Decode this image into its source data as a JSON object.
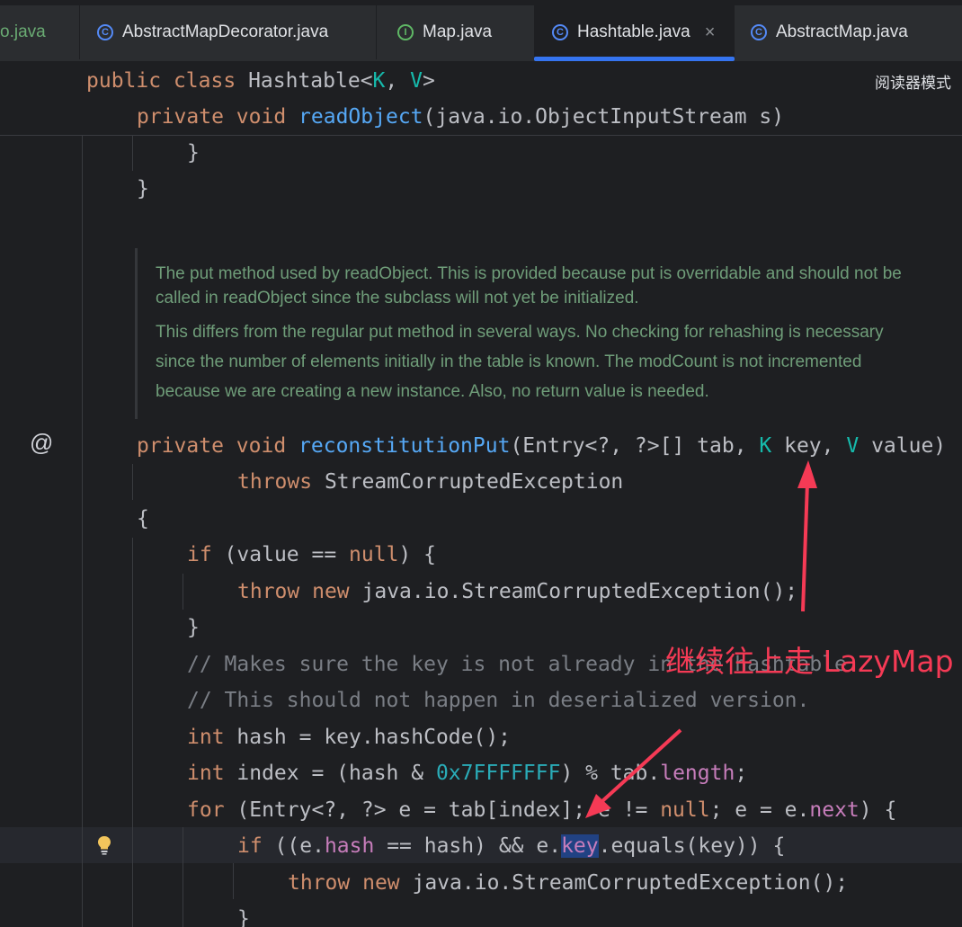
{
  "tabs": [
    {
      "label": "o.java",
      "icon": "none"
    },
    {
      "label": "AbstractMapDecorator.java",
      "icon": "class-icon"
    },
    {
      "label": "Map.java",
      "icon": "interface-icon"
    },
    {
      "label": "Hashtable.java",
      "icon": "class-icon",
      "active": true
    },
    {
      "label": "AbstractMap.java",
      "icon": "class-icon"
    }
  ],
  "tab_icon_letters": {
    "class": "C",
    "interface": "I"
  },
  "close_glyph": "×",
  "reader_mode_label": "阅读器模式",
  "sticky": {
    "line1": {
      "kw1": "public",
      "kw2": "class",
      "name": "Hashtable",
      "lt": "<",
      "k": "K",
      "comma": ", ",
      "v": "V",
      "gt": ">"
    },
    "line2": {
      "kw1": "private",
      "kw2": "void",
      "fn": "readObject",
      "rest": "(java.io.ObjectInputStream s)"
    }
  },
  "code": {
    "brace_close_inner": "}",
    "brace_close_outer": "}",
    "sig_kw1": "private",
    "sig_kw2": "void",
    "sig_fn": "reconstitutionPut",
    "sig_params_a": "(Entry<?, ?>[] tab, ",
    "sig_k": "K",
    "sig_key": " key, ",
    "sig_v": "V",
    "sig_value": " value)",
    "throws_kw": "throws",
    "throws_type": " StreamCorruptedException",
    "open_brace": "{",
    "if_kw": "if",
    "if_cond_a": " (value == ",
    "null1": "null",
    "if_cond_b": ") {",
    "throw_kw": "throw",
    "new_kw": "new",
    "throw_rest": " java.io.StreamCorruptedException();",
    "close_if": "}",
    "comment1": "// Makes sure the key is not already in the hashtable.",
    "comment2": "// This should not happen in deserialized version.",
    "int1": "int",
    "hash_decl": " hash = key.hashCode();",
    "int2": "int",
    "index_a": " index = (hash & ",
    "hex": "0x7FFFFFFF",
    "index_b": ") % tab.",
    "length": "length",
    "semi": ";",
    "for_kw": "for",
    "for_a": " (Entry<?, ?> e = tab[index]; e != ",
    "null2": "null",
    "for_b": "; e = e.",
    "next": "next",
    "for_c": ") {",
    "if2_kw": "if",
    "if2_a": " ((e.",
    "hash_fld": "hash",
    "if2_b": " == hash) && e.",
    "key_fld": "key",
    "if2_c": ".equals(key)) {",
    "throw2_kw": "throw",
    "new2_kw": "new",
    "throw2_rest": " java.io.StreamCorruptedException();",
    "close_last": "}"
  },
  "doc": {
    "p1_line1": "The put method used by readObject. This is provided because put is overridable and should not be",
    "p1_line2": "called in readObject since the subclass will not yet be initialized.",
    "p2_line1": "This differs from the regular put method in several ways. No checking for rehashing is necessary",
    "p2_line2": "since the number of elements initially in the table is known. The modCount is not incremented",
    "p2_line3": "because we are creating a new instance. Also, no return value is needed."
  },
  "gutter": {
    "override_marker": "@"
  },
  "annotation": {
    "text": "继续往上走 LazyMap",
    "color": "#f53a55"
  },
  "colors": {
    "keyword": "#cf8e6d",
    "function": "#56a8f5",
    "type_param": "#16baac",
    "comment": "#7a7e85",
    "field": "#c77dbb",
    "number": "#2aacb8",
    "accent": "#3574f0"
  }
}
